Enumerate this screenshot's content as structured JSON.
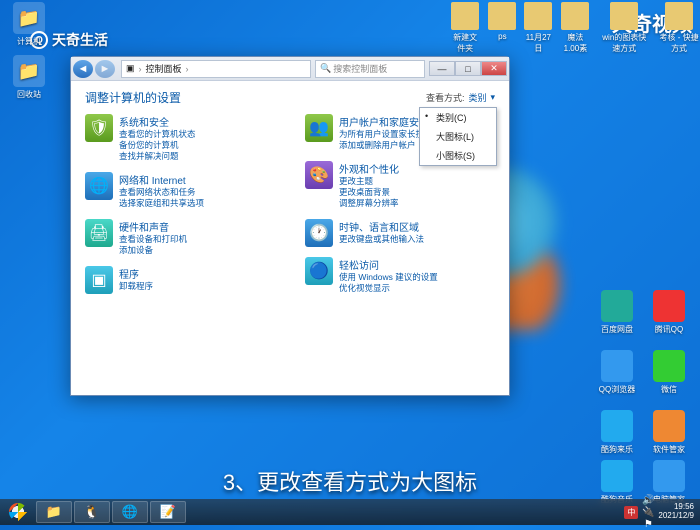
{
  "watermark_right": "天奇视频",
  "watermark_left": "天奇生活",
  "caption": "3、更改查看方式为大图标",
  "desktop": {
    "left": [
      {
        "label": "计算机"
      },
      {
        "label": "回收站"
      }
    ],
    "top": [
      {
        "label": "新建文件夹"
      },
      {
        "label": "ps"
      },
      {
        "label": "11月27日"
      },
      {
        "label": "魔法1.00素"
      },
      {
        "label": "win的图表快速方式"
      },
      {
        "label": "考核 - 快捷方式"
      }
    ],
    "right": [
      {
        "label": "腾讯QQ"
      },
      {
        "label": "百度网盘"
      },
      {
        "label": "微信"
      },
      {
        "label": "QQ浏览器"
      },
      {
        "label": "软件管家"
      },
      {
        "label": "酷狗来乐"
      },
      {
        "label": "电脑管家"
      },
      {
        "label": "酷狗音乐"
      }
    ]
  },
  "window": {
    "nav_back": "◄",
    "nav_fwd": "►",
    "breadcrumb_root": "▣",
    "breadcrumb_item": "控制面板",
    "search_placeholder": "搜索控制面板",
    "min": "—",
    "max": "□",
    "close": "✕",
    "title": "调整计算机的设置",
    "view_label": "查看方式:",
    "view_value": "类别",
    "dropdown": [
      {
        "label": "类别(C)",
        "sel": true
      },
      {
        "label": "大图标(L)",
        "sel": false
      },
      {
        "label": "小图标(S)",
        "sel": false
      }
    ],
    "cats_left": [
      {
        "t": "系统和安全",
        "s": [
          "查看您的计算机状态",
          "备份您的计算机",
          "查找并解决问题"
        ],
        "c": "ci-green",
        "g": "🛡"
      },
      {
        "t": "网络和 Internet",
        "s": [
          "查看网络状态和任务",
          "选择家庭组和共享选项"
        ],
        "c": "ci-blue",
        "g": "🌐"
      },
      {
        "t": "硬件和声音",
        "s": [
          "查看设备和打印机",
          "添加设备"
        ],
        "c": "ci-teal",
        "g": "🖨"
      },
      {
        "t": "程序",
        "s": [
          "卸载程序"
        ],
        "c": "ci-cyan",
        "g": "▣"
      }
    ],
    "cats_right": [
      {
        "t": "用户帐户和家庭安全",
        "s": [
          "为所有用户设置家长控制",
          "添加或删除用户帐户"
        ],
        "c": "ci-green",
        "g": "👥"
      },
      {
        "t": "外观和个性化",
        "s": [
          "更改主题",
          "更改桌面背景",
          "调整屏幕分辨率"
        ],
        "c": "ci-purple",
        "g": "🎨"
      },
      {
        "t": "时钟、语言和区域",
        "s": [
          "更改键盘或其他输入法"
        ],
        "c": "ci-blue",
        "g": "🕐"
      },
      {
        "t": "轻松访问",
        "s": [
          "使用 Windows 建议的设置",
          "优化视觉显示"
        ],
        "c": "ci-cyan",
        "g": "🔵"
      }
    ]
  },
  "taskbar": {
    "items": [
      "📁",
      "🐧",
      "🌐",
      "📝"
    ],
    "tray": [
      "🔊",
      "🔌",
      "⚑"
    ],
    "ime": "中",
    "time": "19:56",
    "date": "2021/12/9"
  }
}
